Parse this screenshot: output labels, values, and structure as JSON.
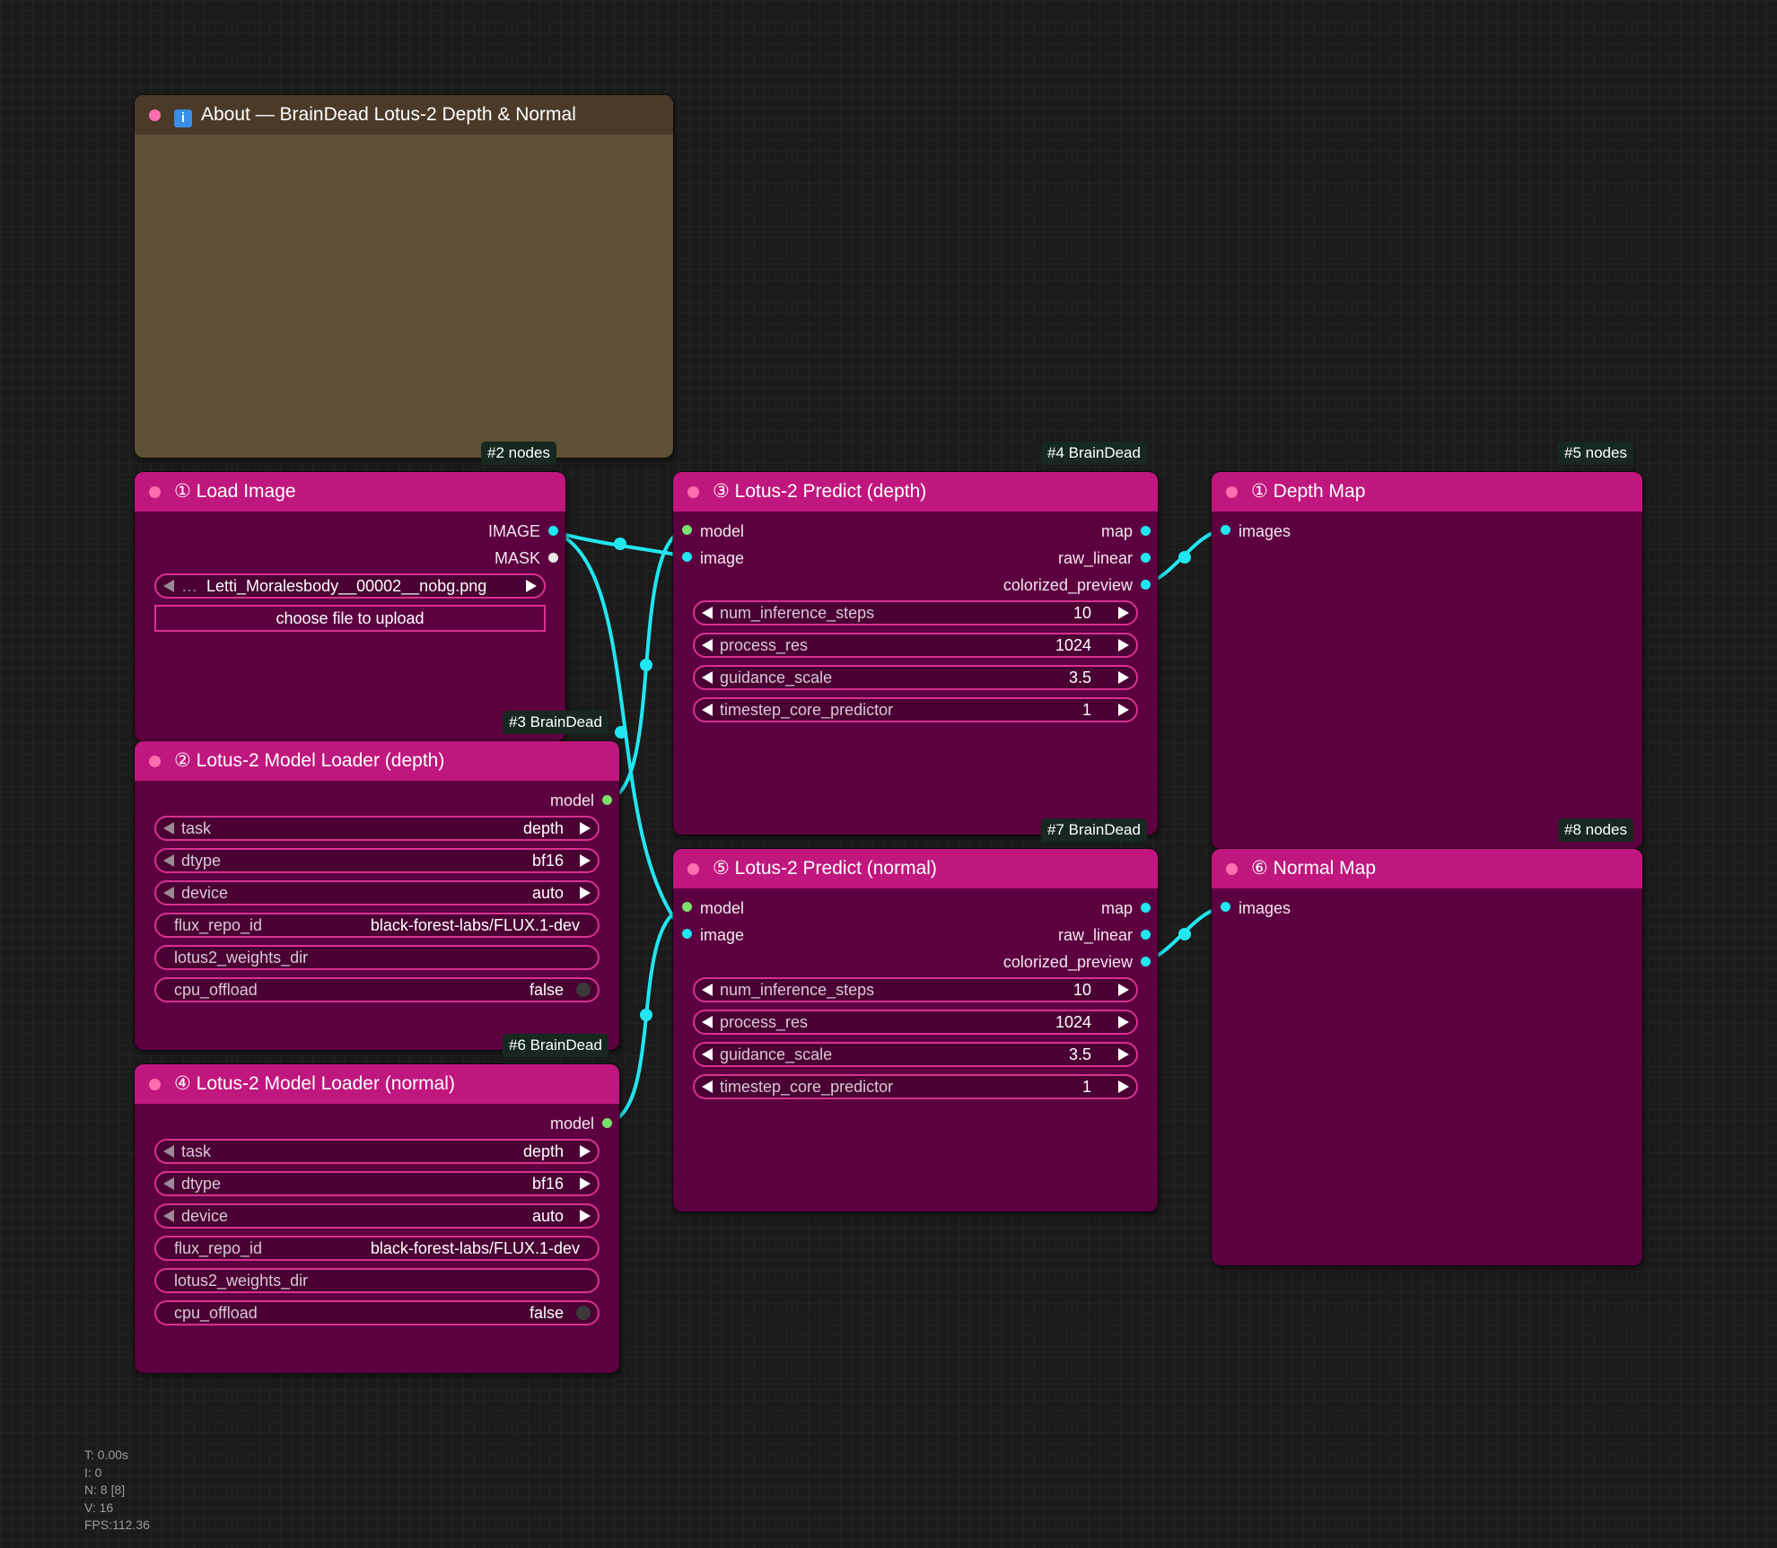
{
  "note": {
    "title": "About — BrainDead Lotus-2 Depth & Normal",
    "icon": "info-icon",
    "badge": "#2 nodes"
  },
  "load_image": {
    "title": "① Load Image",
    "outputs": [
      "IMAGE",
      "MASK"
    ],
    "file_prefix": "…",
    "file_name": "Letti_Moralesbody__00002__nobg.png",
    "upload_label": "choose file to upload",
    "badge": "#3 BrainDead"
  },
  "loader_depth": {
    "title": "② Lotus-2 Model Loader (depth)",
    "output": "model",
    "widgets": [
      {
        "name": "task",
        "value": "depth"
      },
      {
        "name": "dtype",
        "value": "bf16"
      },
      {
        "name": "device",
        "value": "auto"
      },
      {
        "name": "flux_repo_id",
        "value": "black-forest-labs/FLUX.1-dev"
      },
      {
        "name": "lotus2_weights_dir",
        "value": ""
      },
      {
        "name": "cpu_offload",
        "value": "false"
      }
    ],
    "badge": "#6 BrainDead"
  },
  "loader_normal": {
    "title": "④ Lotus-2 Model Loader (normal)",
    "output": "model",
    "widgets": [
      {
        "name": "task",
        "value": "depth"
      },
      {
        "name": "dtype",
        "value": "bf16"
      },
      {
        "name": "device",
        "value": "auto"
      },
      {
        "name": "flux_repo_id",
        "value": "black-forest-labs/FLUX.1-dev"
      },
      {
        "name": "lotus2_weights_dir",
        "value": ""
      },
      {
        "name": "cpu_offload",
        "value": "false"
      }
    ]
  },
  "predict_depth": {
    "title": "③ Lotus-2 Predict (depth)",
    "inputs": [
      "model",
      "image"
    ],
    "outputs": [
      "map",
      "raw_linear",
      "colorized_preview"
    ],
    "widgets": [
      {
        "name": "num_inference_steps",
        "value": "10"
      },
      {
        "name": "process_res",
        "value": "1024"
      },
      {
        "name": "guidance_scale",
        "value": "3.5"
      },
      {
        "name": "timestep_core_predictor",
        "value": "1"
      }
    ],
    "badge": "#4 BrainDead"
  },
  "predict_normal": {
    "title": "⑤ Lotus-2 Predict (normal)",
    "inputs": [
      "model",
      "image"
    ],
    "outputs": [
      "map",
      "raw_linear",
      "colorized_preview"
    ],
    "widgets": [
      {
        "name": "num_inference_steps",
        "value": "10"
      },
      {
        "name": "process_res",
        "value": "1024"
      },
      {
        "name": "guidance_scale",
        "value": "3.5"
      },
      {
        "name": "timestep_core_predictor",
        "value": "1"
      }
    ],
    "badge": "#7 BrainDead"
  },
  "depth_map": {
    "title": "① Depth Map",
    "input": "images",
    "badge": "#5 nodes"
  },
  "normal_map": {
    "title": "⑥ Normal Map",
    "input": "images",
    "badge": "#8 nodes"
  },
  "stats": [
    "T: 0.00s",
    "I: 0",
    "N: 8 [8]",
    "V: 16",
    "FPS:112.36"
  ],
  "colors": {
    "node_body": "#5d0040",
    "node_header": "#c0177e",
    "note_body": "#5e5034",
    "note_header": "#4b3a28",
    "link": "#22e6f0",
    "model_slot": "#7ae26b",
    "widget_border": "#d9318f"
  }
}
